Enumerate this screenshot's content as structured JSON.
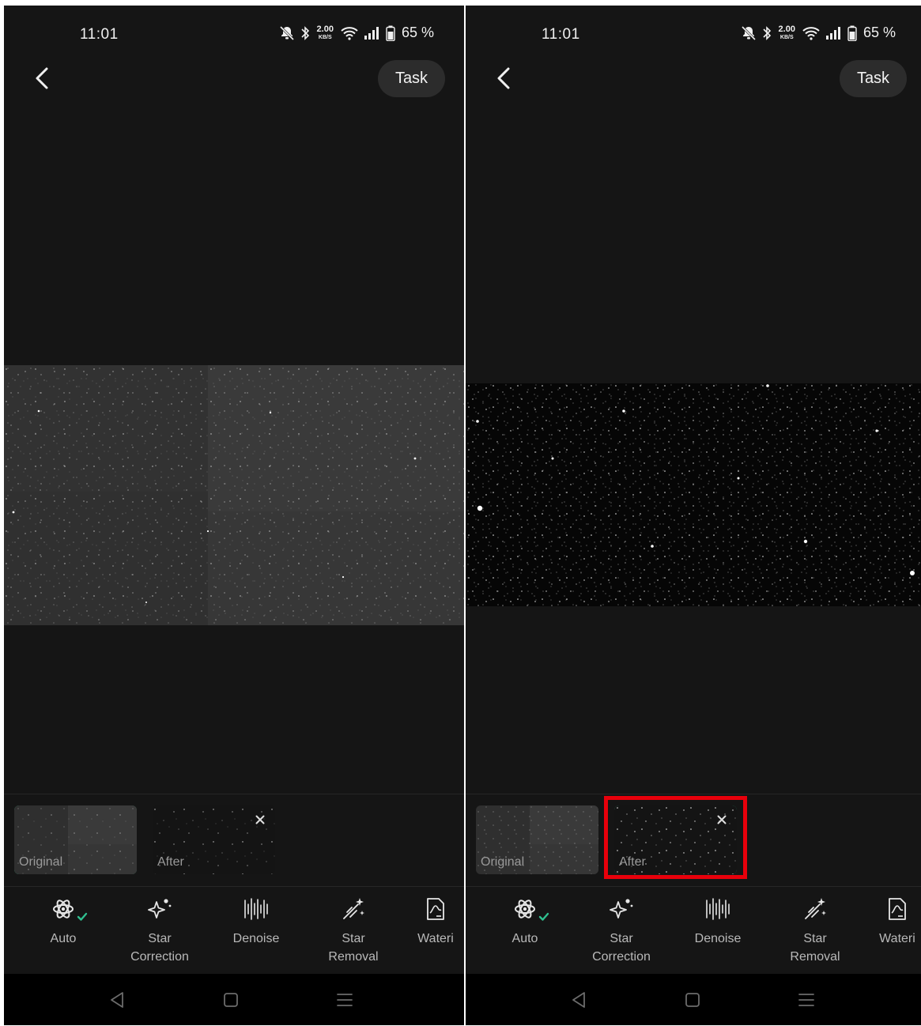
{
  "status_bar": {
    "time": "11:01",
    "speed_value": "2.00",
    "speed_unit": "KB/S",
    "battery": "65 %"
  },
  "header": {
    "task_label": "Task"
  },
  "thumbnails": {
    "original_label": "Original",
    "after_label": "After"
  },
  "tools": [
    {
      "label": "Auto",
      "icon": "atom-icon"
    },
    {
      "label": "Star\nCorrection",
      "icon": "sparkle-icon"
    },
    {
      "label": "Denoise",
      "icon": "waveform-icon"
    },
    {
      "label": "Star\nRemoval",
      "icon": "magic-wand-icon"
    },
    {
      "label": "Wateri",
      "icon": "curve-chart-icon"
    }
  ],
  "colors": {
    "background": "#151515",
    "accent": "#2fbf8f",
    "highlight": "#e8000b",
    "task_button": "#2c2c2c"
  },
  "selection": {
    "left_screen": "Original",
    "right_screen": "After"
  }
}
